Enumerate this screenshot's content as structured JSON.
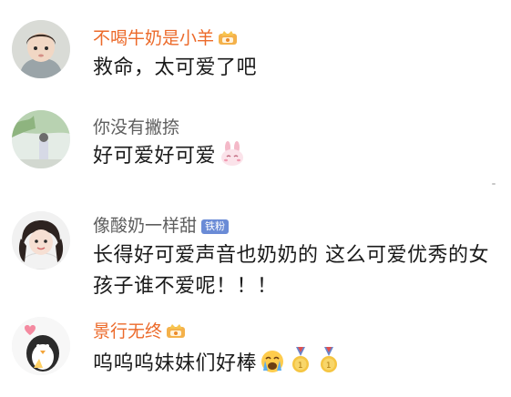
{
  "comments": [
    {
      "username": "不喝牛奶是小羊",
      "text": "救命，太可爱了吧",
      "badge_icon": "crown-badge-icon",
      "badge_text": ""
    },
    {
      "username": "你没有撇捺",
      "text": "好可爱好可爱",
      "emoji_icon": "bunny-emoji-icon"
    },
    {
      "username": "像酸奶一样甜",
      "fan_badge": "铁粉",
      "text": "长得好可爱声音也奶奶的 这么可爱优秀的女孩子谁不爱呢！！！"
    },
    {
      "username": "景行无终",
      "badge_icon": "crown-badge-icon",
      "text": "呜呜呜妹妹们好棒",
      "emoji_icons": [
        "crying-emoji-icon",
        "gold-medal-icon",
        "gold-medal-icon"
      ]
    }
  ],
  "colors": {
    "vip_name": "#ec6a2a",
    "normal_name": "#5e5e5e",
    "text": "#1a1a1a",
    "fan_badge_bg": "#6a8bd6"
  }
}
